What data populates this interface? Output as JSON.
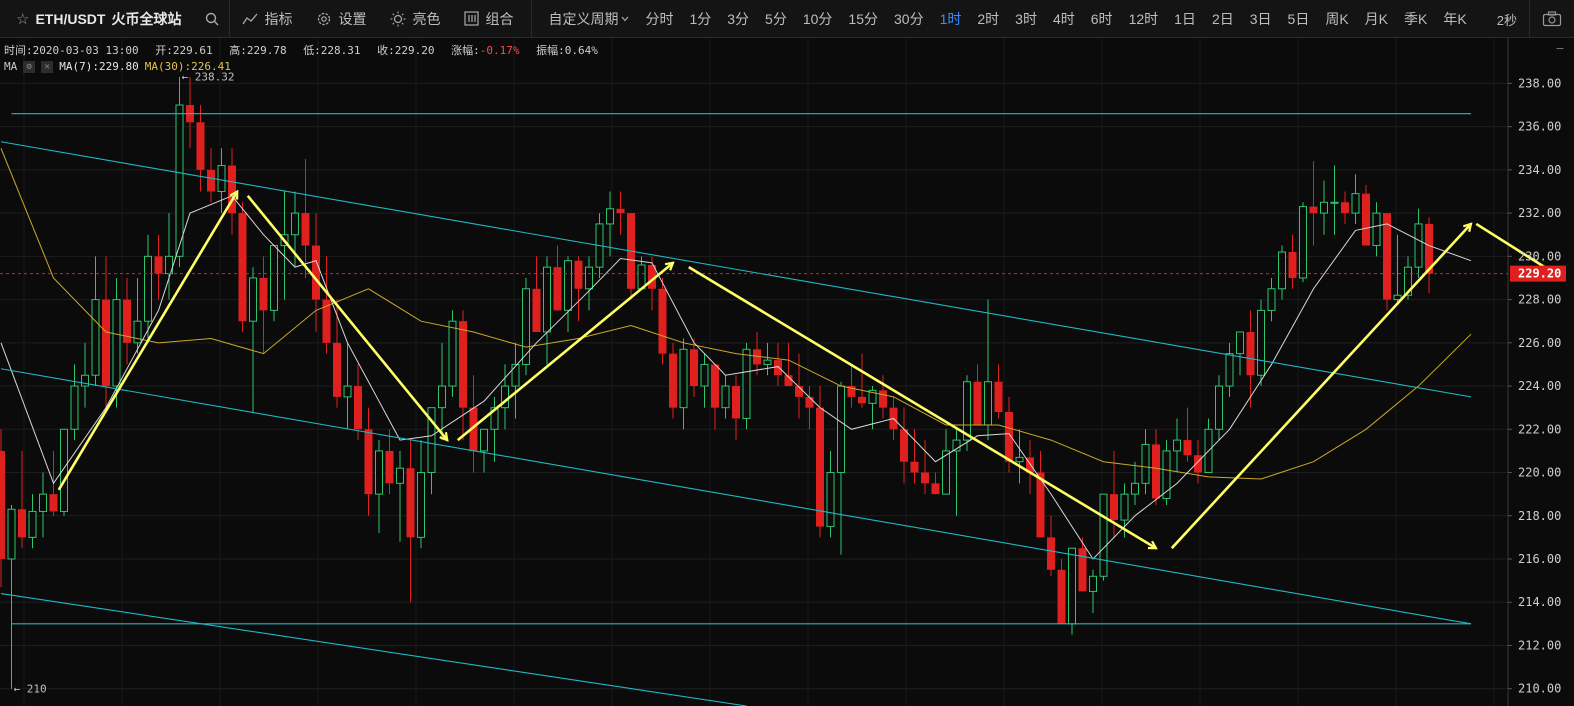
{
  "toolbar": {
    "symbol": "ETH/USDT",
    "exchange": "火币全球站",
    "star_icon": "star-icon",
    "search_icon": "search-icon",
    "tools": [
      {
        "label": "指标",
        "icon": "indicator-icon"
      },
      {
        "label": "设置",
        "icon": "gear-icon"
      },
      {
        "label": "亮色",
        "icon": "sun-icon"
      },
      {
        "label": "组合",
        "icon": "layout-icon"
      }
    ],
    "custom_period": "自定义周期",
    "periods": [
      "分时",
      "1分",
      "3分",
      "5分",
      "10分",
      "15分",
      "30分",
      "1时",
      "2时",
      "3时",
      "4时",
      "6时",
      "12时",
      "1日",
      "2日",
      "3日",
      "5日",
      "周K",
      "月K",
      "季K",
      "年K"
    ],
    "active_period": "1时",
    "refresh": "2秒",
    "camera_icon": "camera-icon",
    "minus_glyph": "−"
  },
  "info": {
    "time": "时间:2020-03-03 13:00",
    "open": "开:229.61",
    "high": "高:229.78",
    "low": "低:228.31",
    "close": "收:229.20",
    "change": "涨幅:-0.17%",
    "amplitude": "振幅:0.64%"
  },
  "ma": {
    "label": "MA",
    "ma7": "MA(7):229.80",
    "ma30": "MA(30):226.41"
  },
  "colors": {
    "up": "#2ec46f",
    "down": "#e0201e",
    "ma7": "#d8d8d8",
    "ma30": "#c9a92a",
    "trend": "#1fb8c6",
    "arrow": "#ffff66",
    "current": "#e0201e"
  },
  "chart_data": {
    "type": "candlestick",
    "y_axis_ticks": [
      "238.00",
      "236.00",
      "234.00",
      "232.00",
      "230.00",
      "228.00",
      "226.00",
      "224.00",
      "222.00",
      "220.00",
      "218.00",
      "216.00",
      "214.00",
      "212.00",
      "210.00"
    ],
    "ylim": [
      209.2,
      240.1
    ],
    "current_price": "229.20",
    "current_price_value": 229.2,
    "annotations": [
      {
        "label": "← 238.32",
        "value": 238.32,
        "index": 17
      },
      {
        "label": "← 210",
        "value": 210.0,
        "index": 1
      }
    ],
    "candles": [
      [
        221,
        222,
        214.7,
        216
      ],
      [
        216,
        218.5,
        210,
        218.3
      ],
      [
        218.3,
        221,
        216.5,
        217
      ],
      [
        217,
        219,
        216.5,
        218.2
      ],
      [
        218.2,
        220,
        217,
        219
      ],
      [
        219,
        221,
        218,
        218.2
      ],
      [
        218.2,
        222,
        218,
        222
      ],
      [
        222,
        225,
        221.5,
        224
      ],
      [
        224,
        226,
        223,
        224.5
      ],
      [
        224.5,
        230,
        224,
        228
      ],
      [
        228,
        230,
        223,
        224
      ],
      [
        224,
        229,
        223,
        228
      ],
      [
        228,
        229,
        225,
        226
      ],
      [
        226,
        229,
        225.5,
        227
      ],
      [
        227,
        231,
        226,
        230
      ],
      [
        230,
        231,
        228,
        229.2
      ],
      [
        229.2,
        232,
        228,
        230
      ],
      [
        230,
        238.3,
        229.5,
        237
      ],
      [
        237,
        238.3,
        235,
        236.2
      ],
      [
        236.2,
        237,
        233,
        234
      ],
      [
        234,
        235,
        232.5,
        233
      ],
      [
        233,
        235,
        232,
        234.2
      ],
      [
        234.2,
        235,
        231,
        232
      ],
      [
        232,
        232.5,
        226.5,
        227
      ],
      [
        227,
        229.5,
        222.8,
        229
      ],
      [
        229,
        230,
        225.5,
        227.5
      ],
      [
        227.5,
        230.5,
        227,
        230.5
      ],
      [
        230.5,
        233,
        228,
        231
      ],
      [
        231,
        233,
        229.5,
        232
      ],
      [
        232,
        234.5,
        229,
        230.5
      ],
      [
        230.5,
        232,
        226.5,
        228
      ],
      [
        228,
        230,
        225.5,
        226
      ],
      [
        226,
        228,
        223,
        223.5
      ],
      [
        223.5,
        226,
        222,
        224
      ],
      [
        224,
        225,
        221.5,
        222
      ],
      [
        222,
        223,
        218,
        219
      ],
      [
        219,
        221.5,
        217.2,
        221
      ],
      [
        221,
        222,
        219,
        219.5
      ],
      [
        219.5,
        221,
        216.8,
        220.2
      ],
      [
        220.2,
        221.5,
        214,
        217
      ],
      [
        217,
        221.5,
        216.5,
        220
      ],
      [
        220,
        223,
        219,
        223
      ],
      [
        223,
        226,
        221.5,
        224
      ],
      [
        224,
        227.5,
        223.5,
        227
      ],
      [
        227,
        227.5,
        221.5,
        223
      ],
      [
        223,
        224.5,
        220,
        221
      ],
      [
        221,
        222,
        220,
        222
      ],
      [
        222,
        223.5,
        220.5,
        223
      ],
      [
        223,
        225,
        222,
        224
      ],
      [
        224,
        226,
        222.5,
        225
      ],
      [
        225,
        229,
        224.5,
        228.5
      ],
      [
        228.5,
        230,
        227,
        226.5
      ],
      [
        226.5,
        230,
        225,
        229.5
      ],
      [
        229.5,
        230.5,
        227.5,
        227.5
      ],
      [
        227.5,
        230,
        226.5,
        229.8
      ],
      [
        229.8,
        230,
        227,
        228.5
      ],
      [
        228.5,
        230,
        227.5,
        229.5
      ],
      [
        229.5,
        232,
        229,
        231.5
      ],
      [
        231.5,
        233,
        230,
        232.2
      ],
      [
        232.2,
        233,
        231,
        232
      ],
      [
        232,
        232,
        228,
        228.5
      ],
      [
        228.5,
        230,
        228.5,
        229.6
      ],
      [
        229.6,
        230,
        227.5,
        228.5
      ],
      [
        228.5,
        229,
        225,
        225.5
      ],
      [
        225.5,
        226,
        222.5,
        223
      ],
      [
        223,
        226.2,
        222,
        225.7
      ],
      [
        225.7,
        226.2,
        223.5,
        224
      ],
      [
        224,
        225.5,
        223,
        225
      ],
      [
        225,
        225,
        222,
        223
      ],
      [
        223,
        224.5,
        222.5,
        224
      ],
      [
        224,
        224.5,
        221.5,
        222.5
      ],
      [
        222.5,
        226,
        222,
        225.7
      ],
      [
        225.7,
        226.5,
        224.5,
        225
      ],
      [
        225,
        226,
        224.5,
        225.2
      ],
      [
        225.2,
        226,
        224,
        224.5
      ],
      [
        224.5,
        226,
        224,
        224
      ],
      [
        224,
        225.5,
        222.5,
        223.5
      ],
      [
        223.5,
        224,
        222,
        223
      ],
      [
        223,
        224,
        217,
        217.5
      ],
      [
        217.5,
        221,
        217,
        220
      ],
      [
        220,
        224.2,
        216.2,
        224
      ],
      [
        224,
        225,
        223,
        223.5
      ],
      [
        223.5,
        225.5,
        223,
        223.2
      ],
      [
        223.2,
        224,
        222,
        223.8
      ],
      [
        223.8,
        224.5,
        222.5,
        223
      ],
      [
        223,
        223.5,
        221.5,
        222
      ],
      [
        222,
        223,
        219.5,
        220.5
      ],
      [
        220.5,
        222,
        219.5,
        220
      ],
      [
        220,
        221.5,
        219,
        219.5
      ],
      [
        219.5,
        220,
        219,
        219
      ],
      [
        219,
        222,
        219,
        221
      ],
      [
        221,
        222,
        218,
        221.5
      ],
      [
        221.5,
        224.5,
        221,
        224.2
      ],
      [
        224.2,
        225,
        222.5,
        222.2
      ],
      [
        222.2,
        228,
        221.5,
        224.2
      ],
      [
        224.2,
        225,
        222.5,
        222.8
      ],
      [
        222.8,
        223.5,
        220,
        220.5
      ],
      [
        220.5,
        222,
        219.5,
        220.7
      ],
      [
        220.7,
        221.5,
        219,
        220
      ],
      [
        220,
        221,
        217,
        217
      ],
      [
        217,
        218,
        215.2,
        215.5
      ],
      [
        215.5,
        216,
        213,
        213
      ],
      [
        213,
        216.5,
        212.5,
        216.5
      ],
      [
        216.5,
        217,
        214.5,
        214.5
      ],
      [
        214.5,
        215.5,
        213.5,
        215.2
      ],
      [
        215.2,
        219,
        215,
        219
      ],
      [
        219,
        221,
        217,
        217.8
      ],
      [
        217.8,
        219.5,
        217,
        219
      ],
      [
        219,
        220.5,
        218.5,
        219.5
      ],
      [
        219.5,
        222,
        219,
        221.3
      ],
      [
        221.3,
        222,
        218.5,
        218.8
      ],
      [
        218.8,
        221.5,
        218.5,
        221
      ],
      [
        221,
        222.5,
        220,
        221.5
      ],
      [
        221.5,
        223,
        220.5,
        220.8
      ],
      [
        220.8,
        221.5,
        219.5,
        220
      ],
      [
        220,
        222.5,
        220,
        222
      ],
      [
        222,
        224.5,
        221.5,
        224
      ],
      [
        224,
        226,
        223.5,
        225.5
      ],
      [
        225.5,
        226.5,
        224.5,
        226.5
      ],
      [
        226.5,
        227.5,
        223,
        224.5
      ],
      [
        224.5,
        228,
        224,
        227.5
      ],
      [
        227.5,
        229,
        227,
        228.5
      ],
      [
        228.5,
        230.5,
        228,
        230.2
      ],
      [
        230.2,
        231,
        228.5,
        229
      ],
      [
        229,
        232.5,
        228.8,
        232.3
      ],
      [
        232.3,
        234.4,
        230.5,
        232
      ],
      [
        232,
        233.5,
        231,
        232.5
      ],
      [
        232.5,
        234.2,
        231,
        232.5
      ],
      [
        232.5,
        233,
        231.5,
        232
      ],
      [
        232,
        233.8,
        231.5,
        232.9
      ],
      [
        232.9,
        233.3,
        230.5,
        230.5
      ],
      [
        230.5,
        232.5,
        230,
        232
      ],
      [
        232,
        232,
        227.5,
        228
      ],
      [
        228,
        231,
        227.8,
        228.2
      ],
      [
        228.2,
        230,
        228,
        229.5
      ],
      [
        229.5,
        232.2,
        229,
        231.5
      ],
      [
        231.5,
        231.8,
        228.3,
        229.2
      ]
    ],
    "ma7": [
      [
        0,
        226
      ],
      [
        5,
        219.5
      ],
      [
        10,
        223
      ],
      [
        15,
        227.5
      ],
      [
        18,
        232
      ],
      [
        22,
        232.8
      ],
      [
        25,
        231
      ],
      [
        28,
        229.5
      ],
      [
        30,
        229.8
      ],
      [
        33,
        226
      ],
      [
        38,
        221.5
      ],
      [
        41,
        221.7
      ],
      [
        46,
        223.3
      ],
      [
        51,
        226
      ],
      [
        56,
        228.4
      ],
      [
        59,
        229.9
      ],
      [
        62,
        229.7
      ],
      [
        66,
        226
      ],
      [
        69,
        224.5
      ],
      [
        74,
        224.9
      ],
      [
        78,
        223
      ],
      [
        81,
        222
      ],
      [
        85,
        222.5
      ],
      [
        89,
        220.5
      ],
      [
        93,
        221.7
      ],
      [
        96,
        221.8
      ],
      [
        100,
        219
      ],
      [
        104,
        216
      ],
      [
        108,
        218
      ],
      [
        112,
        219.5
      ],
      [
        117,
        222
      ],
      [
        121,
        225
      ],
      [
        125,
        228.5
      ],
      [
        129,
        231.2
      ],
      [
        132,
        231.5
      ],
      [
        136,
        230.5
      ],
      [
        140,
        229.8
      ]
    ],
    "ma30": [
      [
        0,
        235
      ],
      [
        5,
        229
      ],
      [
        10,
        226.5
      ],
      [
        15,
        226
      ],
      [
        20,
        226.2
      ],
      [
        25,
        225.5
      ],
      [
        30,
        227.5
      ],
      [
        35,
        228.5
      ],
      [
        40,
        227
      ],
      [
        45,
        226.5
      ],
      [
        50,
        225.8
      ],
      [
        55,
        226.2
      ],
      [
        60,
        226.8
      ],
      [
        65,
        226
      ],
      [
        70,
        225.5
      ],
      [
        75,
        225.2
      ],
      [
        80,
        224
      ],
      [
        85,
        223.5
      ],
      [
        90,
        222.2
      ],
      [
        95,
        222.2
      ],
      [
        100,
        221.5
      ],
      [
        105,
        220.5
      ],
      [
        110,
        220.2
      ],
      [
        115,
        219.8
      ],
      [
        120,
        219.7
      ],
      [
        125,
        220.5
      ],
      [
        130,
        222
      ],
      [
        135,
        224
      ],
      [
        140,
        226.4
      ]
    ],
    "trend_lines": [
      {
        "from": [
          1,
          236.6
        ],
        "to": [
          140,
          236.6
        ]
      },
      {
        "from": [
          1,
          213.0
        ],
        "to": [
          140,
          213.0
        ]
      },
      {
        "from": [
          0,
          235.3
        ],
        "to": [
          140,
          223.5
        ]
      },
      {
        "from": [
          0,
          224.8
        ],
        "to": [
          140,
          213.0
        ]
      },
      {
        "from": [
          0,
          214.4
        ],
        "to": [
          71,
          209.2
        ]
      }
    ],
    "arrows": [
      {
        "from": [
          5.5,
          219.2
        ],
        "to": [
          22.5,
          233.0
        ]
      },
      {
        "from": [
          23.5,
          232.8
        ],
        "to": [
          42.5,
          221.5
        ]
      },
      {
        "from": [
          43.5,
          221.5
        ],
        "to": [
          64.0,
          229.7
        ]
      },
      {
        "from": [
          65.5,
          229.5
        ],
        "to": [
          110.0,
          216.5
        ]
      },
      {
        "from": [
          111.5,
          216.5
        ],
        "to": [
          140.0,
          231.5
        ]
      },
      {
        "from": [
          140.5,
          231.5
        ],
        "to": [
          148.0,
          229.2
        ]
      }
    ]
  }
}
